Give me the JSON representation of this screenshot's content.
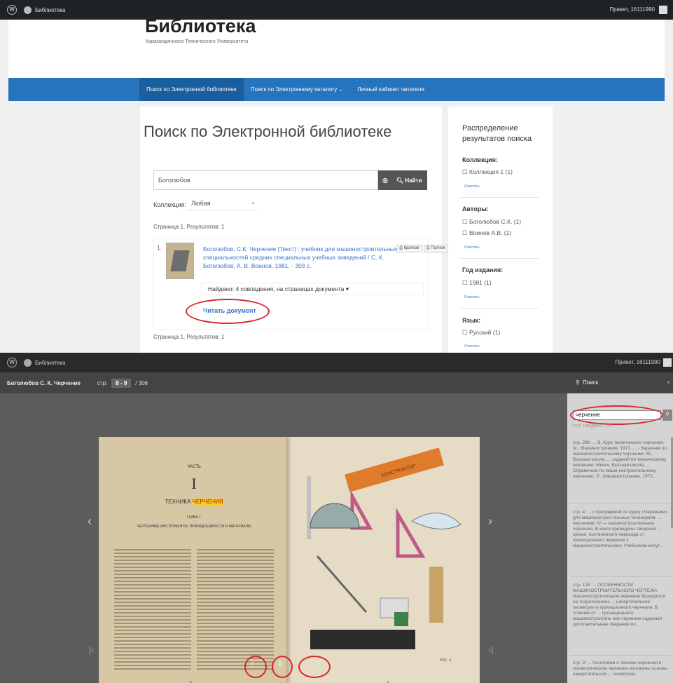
{
  "top": {
    "wpbar": {
      "site_name": "Библиотека",
      "greeting": "Привет, 16111990"
    },
    "header": {
      "title": "Библиотека",
      "subtitle": "Карагандинского Технического Университета"
    },
    "nav": [
      "Поиск по Электронной библиотеке",
      "Поиск по Электронному каталогу",
      "Личный кабинет читателя"
    ],
    "nav_dropdown_icon": "chevron-down-icon",
    "page_title": "Поиск по Электронной библиотеке",
    "search": {
      "value": "Боголюбов",
      "button": "Найти"
    },
    "collection": {
      "label": "Коллекция:",
      "value": "Любая"
    },
    "page_info": "Страница 1, Результатов: 1",
    "result": {
      "number": "1.",
      "title": "Боголюбов, С.К. Черчение [Текст] : учебник для машиностроительных специальностей средних специальных учебных заведений / С. К. Боголюбов, А. В. Воинов. 1981. - 303 с.",
      "btn_short": "Краткое",
      "btn_full": "Полное",
      "found": "Найдено: 4 совпадения, на страницах документа",
      "read": "Читать документ"
    },
    "sidebar": {
      "heading": "Распределение результатов поиска",
      "clear": "Очистить",
      "sections": [
        {
          "title": "Коллекция:",
          "options": [
            "Коллекция 1 (1)"
          ]
        },
        {
          "title": "Авторы:",
          "options": [
            "Боголюбов С.К. (1)",
            "Воинов А.В. (1)"
          ]
        },
        {
          "title": "Год издания:",
          "options": [
            "1981 (1)"
          ]
        },
        {
          "title": "Язык:",
          "options": [
            "Русский (1)"
          ]
        }
      ]
    }
  },
  "reader": {
    "wpbar": {
      "site_name": "Библиотека",
      "greeting": "Привет, 16111990"
    },
    "doc_title": "Боголюбов С. К. Черчение",
    "page_label": "стр:",
    "page_current": "8 - 9",
    "page_total": "/ 306",
    "book": {
      "part_label": "ЧАСТЬ",
      "part_num": "I",
      "part_title_a": "ТЕХНИКА ",
      "part_title_b": "ЧЕРЧЕНИЯ",
      "chapter": "ГЛАВА 1",
      "chapter_title": "ЧЕРТЕЖНЫЕ ИНСТРУМЕНТЫ, ПРИНАДЛЕЖНОСТИ И МАТЕРИАЛЫ",
      "box_label": "КОНСТРУКТОР",
      "fig": "РИС. 4",
      "page_left": "8",
      "page_right": "9"
    },
    "search": {
      "title": "Поиск",
      "value": "черчение",
      "count": "стр. найдено - 70",
      "results": [
        "стр. 296: ... В. Курс технического черчения. М., Машиностроение, 1973. ... - Задачник по машиностроительному черчению. М., Высшая школа, ... заданий по техническому черчению. Минск, Высшая школа, ... Справочник по маши-ностроительному черчению. Л., Машиностроение, 1972. ...",
        "стр. 4: ... с программой по курсу «Черчение» для машинострои-тельных техникумов. ... чер-чение; IV — машиностроительное черчение. В книге приведены сведения ... целью; постепенного перехода от проекционного черчения к машиностроительному. Учебником могут ...",
        "стр. 125: ... ОСОБЕННОСТИ МАШИНОСТРОИТЕЛЬНОГО ЧЕРТЕЖА Машиностроительное черчение базируется на теоретических ... начертательной геометрии и проекционного черчения. В отличие от ... проекционного машиностроитель ное черчение содержит дополнительные сведения по ...",
        "стр. 3: ... понятиями о технике черчения и геометрическом черчении изложены основы начертательной ... геометрии,"
      ]
    }
  },
  "colors": {
    "nav": "#2673be",
    "link": "#3a74c4",
    "annotation": "#d9262c",
    "highlight": "#f2d21b"
  }
}
